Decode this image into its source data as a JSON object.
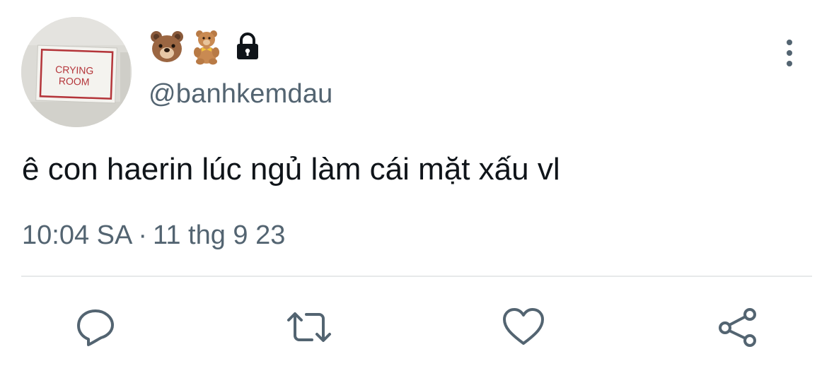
{
  "profile": {
    "avatar_sign_text": "CRYING\nROOM",
    "display_name_icons": [
      "bear-face-icon",
      "teddy-bear-icon"
    ],
    "protected_icon": "lock-icon",
    "handle": "@banhkemdau"
  },
  "tweet": {
    "text": "ê con haerin lúc ngủ làm cái mặt xấu vl",
    "time": "10:04 SA",
    "separator": "·",
    "date": "11 thg 9 23"
  },
  "actions": {
    "icons": [
      "reply-icon",
      "retweet-icon",
      "like-icon",
      "share-icon"
    ]
  },
  "colors": {
    "text_primary": "#0f1419",
    "text_secondary": "#536471",
    "icon": "#536471",
    "divider": "#e7e9ea",
    "sign_red": "#b4353a"
  }
}
